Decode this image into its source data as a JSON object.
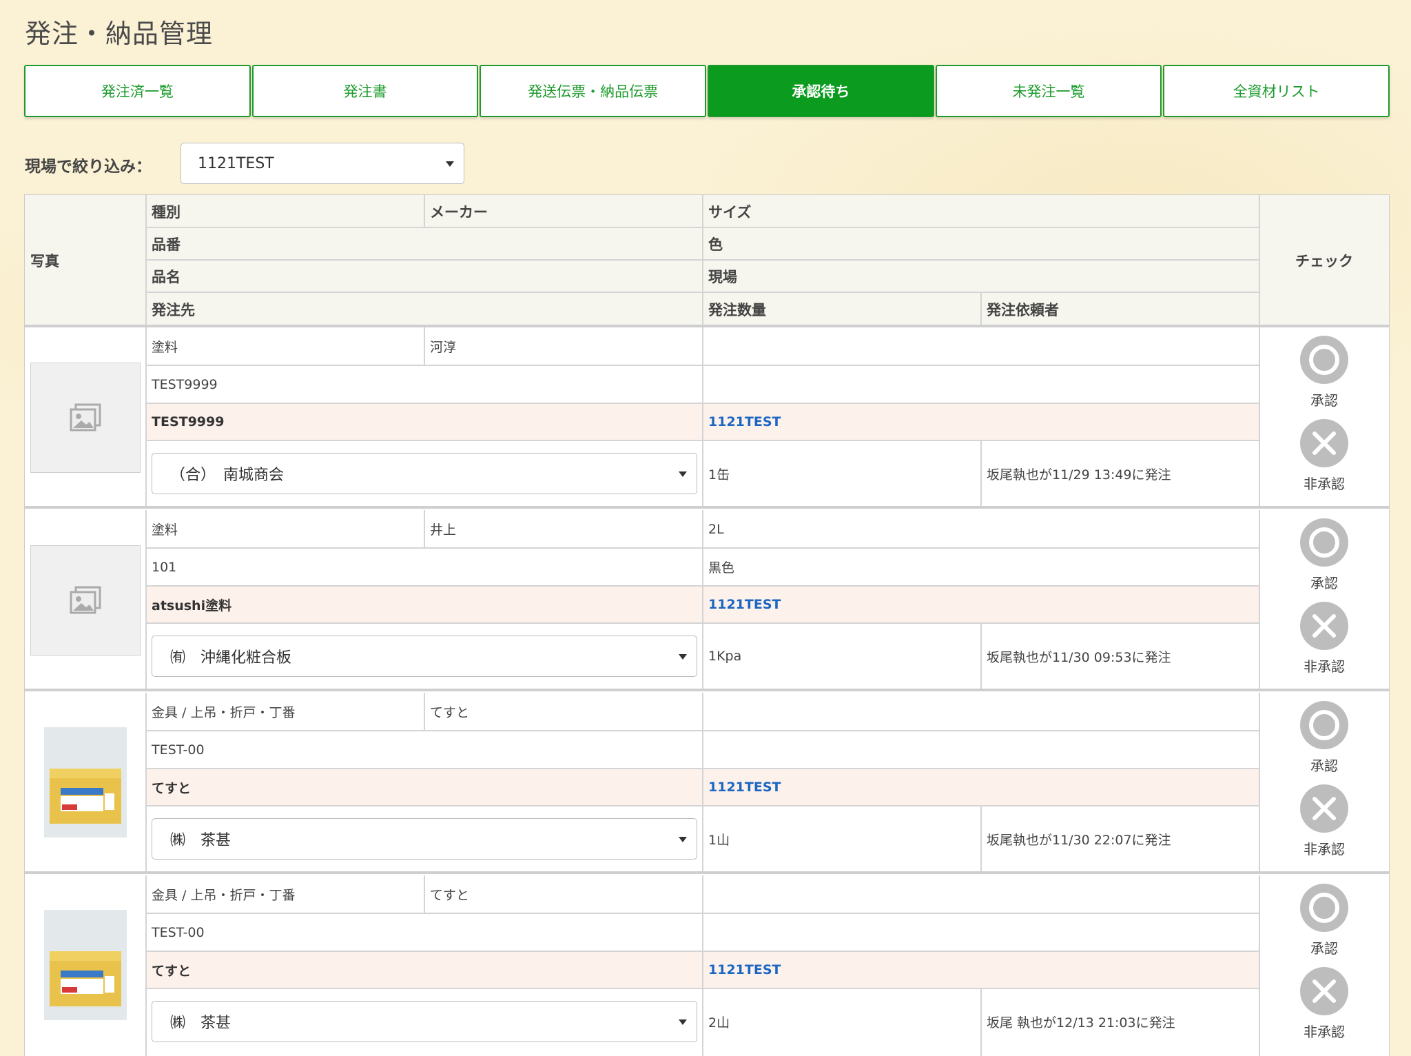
{
  "page": {
    "title": "発注・納品管理"
  },
  "tabs": [
    {
      "label": "発注済一覧",
      "active": false
    },
    {
      "label": "発注書",
      "active": false
    },
    {
      "label": "発送伝票・納品伝票",
      "active": false
    },
    {
      "label": "承認待ち",
      "active": true
    },
    {
      "label": "未発注一覧",
      "active": false
    },
    {
      "label": "全資材リスト",
      "active": false
    }
  ],
  "filter": {
    "label": "現場で絞り込み：",
    "selected": "1121TEST"
  },
  "headers": {
    "photo": "写真",
    "type": "種別",
    "maker": "メーカー",
    "size": "サイズ",
    "part_no": "品番",
    "color": "色",
    "name": "品名",
    "site": "現場",
    "supplier": "発注先",
    "quantity": "発注数量",
    "requester": "発注依頼者",
    "check": "チェック"
  },
  "actions": {
    "approve": "承認",
    "reject": "非承認"
  },
  "rows": [
    {
      "photo": "placeholder",
      "type": "塗料",
      "maker": "河淳",
      "size": "",
      "part_no": "TEST9999",
      "color": "",
      "name": "TEST9999",
      "site": "1121TEST",
      "supplier": "（合）　南城商会",
      "quantity": "1缶",
      "requester": "坂尾執也が11/29 13:49に発注"
    },
    {
      "photo": "placeholder",
      "type": "塗料",
      "maker": "井上",
      "size": "2L",
      "part_no": "101",
      "color": "黒色",
      "name": "atsushi塗料",
      "site": "1121TEST",
      "supplier": "㈲　沖縄化粧合板",
      "quantity": "1Kpa",
      "requester": "坂尾執也が11/30 09:53に発注"
    },
    {
      "photo": "product",
      "type": "金具 / 上吊・折戸・丁番",
      "maker": "てすと",
      "size": "",
      "part_no": "TEST-00",
      "color": "",
      "name": "てすと",
      "site": "1121TEST",
      "supplier": "㈱　茶甚",
      "quantity": "1山",
      "requester": "坂尾執也が11/30 22:07に発注"
    },
    {
      "photo": "product",
      "type": "金具 / 上吊・折戸・丁番",
      "maker": "てすと",
      "size": "",
      "part_no": "TEST-00",
      "color": "",
      "name": "てすと",
      "site": "1121TEST",
      "supplier": "㈱　茶甚",
      "quantity": "2山",
      "requester": "坂尾 執也が12/13 21:03に発注"
    }
  ],
  "colors": {
    "accent": "#0a9b1f",
    "site_link": "#1a66c2",
    "highlight_row": "#fdf1ec"
  }
}
